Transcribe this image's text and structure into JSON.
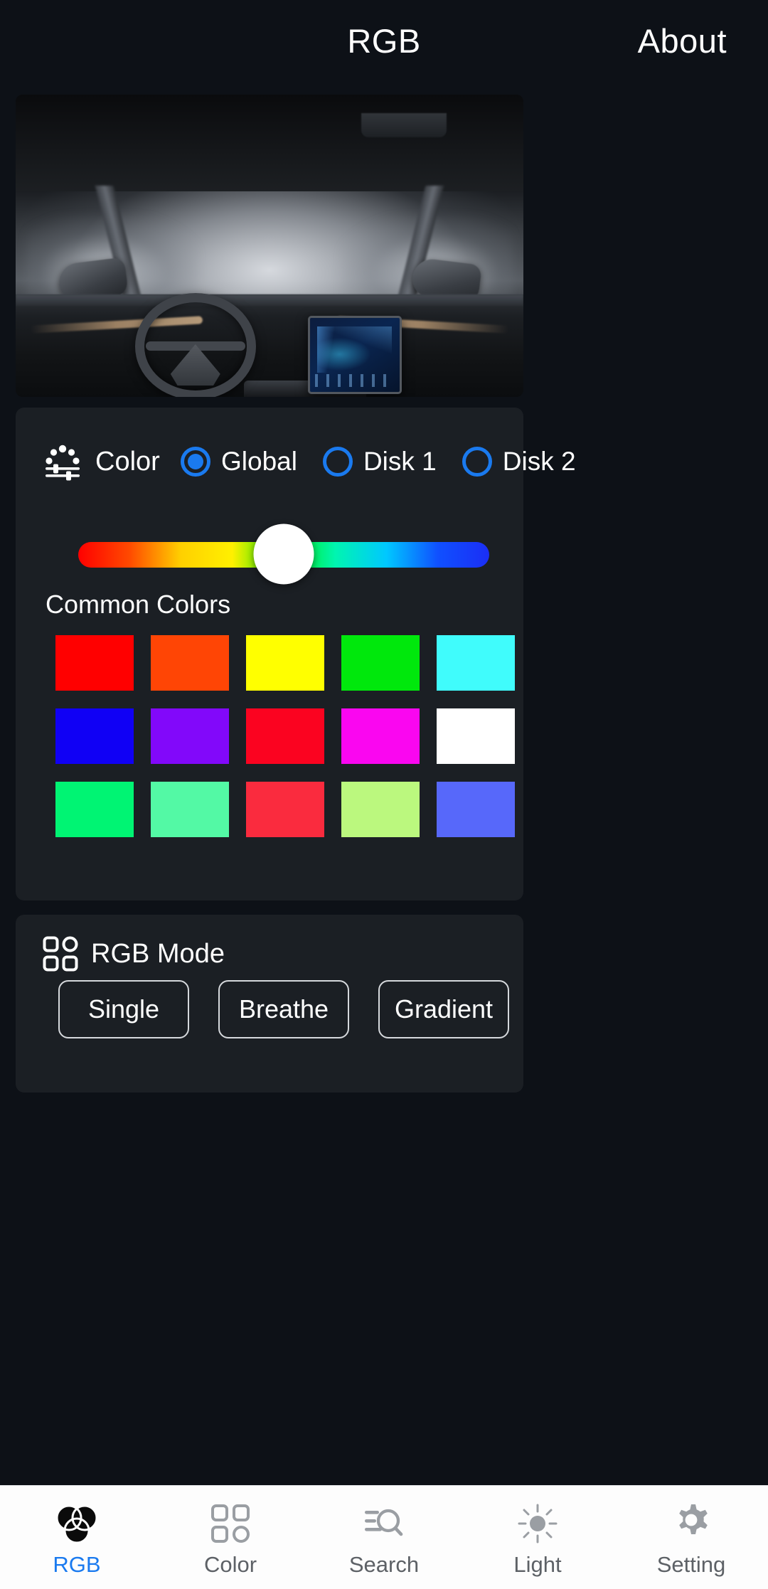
{
  "header": {
    "title": "RGB",
    "about_label": "About"
  },
  "preview": {
    "alt": "car-interior-photo"
  },
  "color_section": {
    "icon": "color-slider-icon",
    "title": "Color",
    "targets": [
      {
        "label": "Global",
        "selected": true
      },
      {
        "label": "Disk 1",
        "selected": false
      },
      {
        "label": "Disk 2",
        "selected": false
      }
    ],
    "accent_color": "#1a7aef",
    "slider": {
      "name": "hue-slider",
      "value_percent": 50,
      "gradient_stops": [
        "#ff0000",
        "#ff4a00",
        "#ffd000",
        "#fff000",
        "#00e800",
        "#00f5b0",
        "#00c8ff",
        "#1050ff",
        "#1b2ef5"
      ],
      "thumb_color": "#ffffff"
    },
    "common_colors_title": "Common Colors",
    "swatches": [
      {
        "name": "red",
        "hex": "#FF0000"
      },
      {
        "name": "orange-red",
        "hex": "#FF4505"
      },
      {
        "name": "yellow",
        "hex": "#FFFF00"
      },
      {
        "name": "green",
        "hex": "#00E80C"
      },
      {
        "name": "cyan",
        "hex": "#40FCFC"
      },
      {
        "name": "blue",
        "hex": "#1000F5"
      },
      {
        "name": "purple",
        "hex": "#8208FA"
      },
      {
        "name": "crimson",
        "hex": "#FB0320"
      },
      {
        "name": "magenta",
        "hex": "#FA06F0"
      },
      {
        "name": "white",
        "hex": "#FFFFFF"
      },
      {
        "name": "spring-green",
        "hex": "#00F473"
      },
      {
        "name": "mint",
        "hex": "#53F9A5"
      },
      {
        "name": "red-pink",
        "hex": "#FA2B3E"
      },
      {
        "name": "light-green",
        "hex": "#BBF87E"
      },
      {
        "name": "periwinkle",
        "hex": "#5768FA"
      }
    ]
  },
  "rgb_mode_section": {
    "icon": "grid-mode-icon",
    "title": "RGB Mode",
    "modes": [
      {
        "label": "Single"
      },
      {
        "label": "Breathe"
      },
      {
        "label": "Gradient"
      }
    ]
  },
  "bottom_nav": {
    "items": [
      {
        "label": "RGB",
        "icon": "rgb-venn-icon",
        "active": true
      },
      {
        "label": "Color",
        "icon": "grid-color-icon",
        "active": false
      },
      {
        "label": "Search",
        "icon": "search-icon",
        "active": false
      },
      {
        "label": "Light",
        "icon": "sun-icon",
        "active": false
      },
      {
        "label": "Setting",
        "icon": "gear-icon",
        "active": false
      }
    ],
    "active_color": "#1a7aef",
    "inactive_color": "#9a9ea3"
  }
}
